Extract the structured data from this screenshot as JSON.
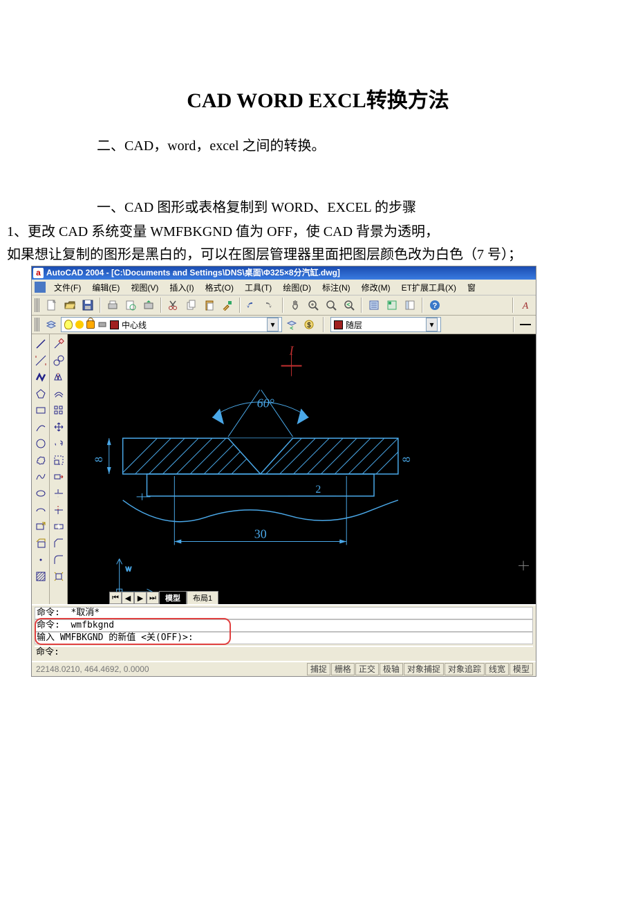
{
  "doc": {
    "title": "CAD WORD EXCL转换方法",
    "intro": "二、CAD，word，excel 之间的转换。",
    "section": "一、CAD 图形或表格复制到 WORD、EXCEL 的步骤",
    "line1": "1、更改 CAD 系统变量 WMFBKGND 值为 OFF，使 CAD 背景为透明，",
    "line2": "如果想让复制的图形是黑白的，可以在图层管理器里面把图层颜色改为白色（7 号）；"
  },
  "cad": {
    "app_icon": "a",
    "title": "AutoCAD 2004 - [C:\\Documents and Settings\\DNS\\桌面\\Φ325×8分汽缸.dwg]",
    "menu": [
      "文件(F)",
      "编辑(E)",
      "视图(V)",
      "插入(I)",
      "格式(O)",
      "工具(T)",
      "绘图(D)",
      "标注(N)",
      "修改(M)",
      "ET扩展工具(X)",
      "窗"
    ],
    "layer_name": "中心线",
    "color_label": "随层",
    "tabs": {
      "model": "模型",
      "layout1": "布局1"
    },
    "drawing": {
      "ang": "60°",
      "dim_h": "30",
      "dim_v": "2",
      "dim_side": "8"
    },
    "cmd": {
      "l1": "命令:  *取消*",
      "l2": "命令:  wmfbkgnd",
      "l3": "输入 WMFBKGND 的新值 <关(OFF)>:",
      "l4": "命令:"
    },
    "status": {
      "coords": "22148.0210, 464.4692, 0.0000",
      "buttons": [
        "捕捉",
        "栅格",
        "正交",
        "极轴",
        "对象捕捉",
        "对象追踪",
        "线宽",
        "模型"
      ]
    }
  }
}
